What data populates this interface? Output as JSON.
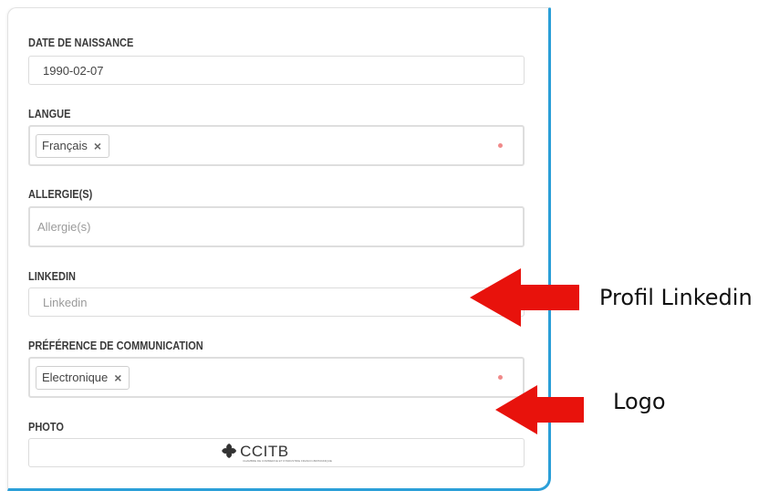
{
  "form": {
    "birthdate": {
      "label": "DATE DE NAISSANCE",
      "value": "1990-02-07"
    },
    "language": {
      "label": "LANGUE",
      "tag": "Français",
      "remove": "×"
    },
    "allergies": {
      "label": "ALLERGIE(S)",
      "placeholder": "Allergie(s)"
    },
    "linkedin": {
      "label": "LINKEDIN",
      "placeholder": "Linkedin"
    },
    "communication": {
      "label": "PRÉFÉRENCE DE COMMUNICATION",
      "tag": "Electronique",
      "remove": "×"
    },
    "photo": {
      "label": "PHOTO",
      "logo_text": "CCITB",
      "logo_subtext": "CHAMBRE DE COMMERCE ET D'INDUSTRIE FRANCO-BRITANNIQUE"
    }
  },
  "annotations": {
    "linkedin_note": "Profil Linkedin",
    "logo_note": "Logo"
  },
  "colors": {
    "accent_border": "#2b9fd8",
    "required_dot": "#f08a8a",
    "arrow": "#e8120c"
  }
}
